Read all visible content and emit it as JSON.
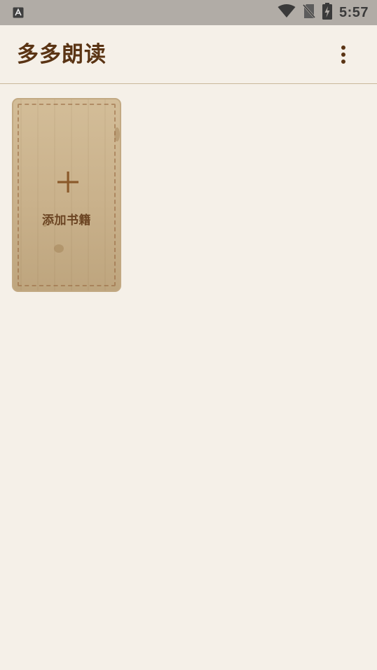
{
  "status_bar": {
    "time": "5:57",
    "icons": [
      "app-notification-icon",
      "wifi-icon",
      "no-sim-icon",
      "battery-charging-icon"
    ]
  },
  "app_bar": {
    "title": "多多朗读",
    "menu_icon": "more-vert-icon"
  },
  "shelf": {
    "add_book_label": "添加书籍",
    "add_icon": "plus-icon"
  },
  "colors": {
    "background": "#f5f0e8",
    "status_bar": "#b1aca6",
    "title": "#5a3414",
    "card_wood": "#c9b18b",
    "accent_brown": "#8b5a2b"
  }
}
